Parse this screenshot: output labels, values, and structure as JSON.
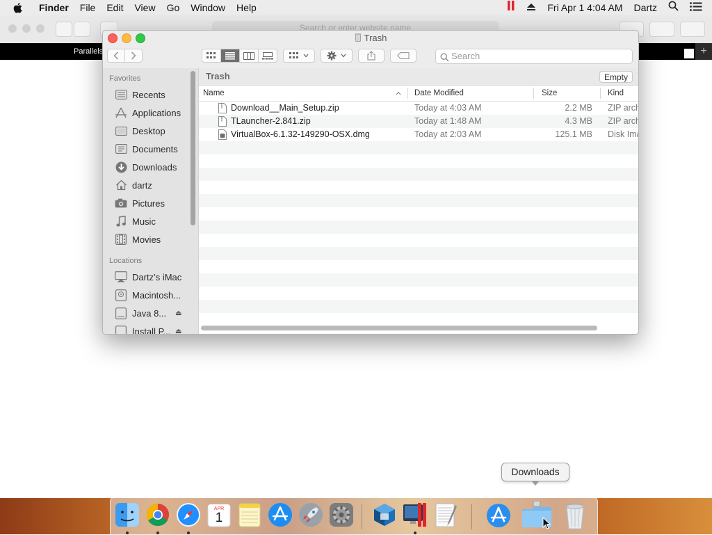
{
  "menubar": {
    "app_name": "Finder",
    "menus": [
      "File",
      "Edit",
      "View",
      "Go",
      "Window",
      "Help"
    ],
    "clock": "Fri Apr 1  4:04 AM",
    "user": "Dartz"
  },
  "background_window": {
    "address_placeholder": "Search or enter website name",
    "tab_label": "Parallels"
  },
  "finder": {
    "window_title": "Trash",
    "search_placeholder": "Search",
    "path_title": "Trash",
    "empty_button": "Empty",
    "columns": {
      "name": "Name",
      "date_modified": "Date Modified",
      "size": "Size",
      "kind": "Kind"
    },
    "files": [
      {
        "name": "Download__Main_Setup.zip",
        "date": "Today at 4:03 AM",
        "size": "2.2 MB",
        "kind": "ZIP archive",
        "icon": "zip-file-icon"
      },
      {
        "name": "TLauncher-2.841.zip",
        "date": "Today at 1:48 AM",
        "size": "4.3 MB",
        "kind": "ZIP archive",
        "icon": "zip-file-icon"
      },
      {
        "name": "VirtualBox-6.1.32-149290-OSX.dmg",
        "date": "Today at 2:03 AM",
        "size": "125.1 MB",
        "kind": "Disk Image",
        "icon": "disk-image-icon"
      }
    ]
  },
  "sidebar": {
    "favorites_header": "Favorites",
    "favorites": [
      {
        "label": "Recents",
        "icon": "recents-icon"
      },
      {
        "label": "Applications",
        "icon": "applications-icon"
      },
      {
        "label": "Desktop",
        "icon": "desktop-icon"
      },
      {
        "label": "Documents",
        "icon": "documents-icon"
      },
      {
        "label": "Downloads",
        "icon": "downloads-icon"
      },
      {
        "label": "dartz",
        "icon": "home-icon"
      },
      {
        "label": "Pictures",
        "icon": "pictures-icon"
      },
      {
        "label": "Music",
        "icon": "music-icon"
      },
      {
        "label": "Movies",
        "icon": "movies-icon"
      }
    ],
    "locations_header": "Locations",
    "locations": [
      {
        "label": "Dartz’s iMac",
        "icon": "imac-icon"
      },
      {
        "label": "Macintosh...",
        "icon": "hard-disk-icon"
      },
      {
        "label": "Java 8...",
        "icon": "external-disk-icon",
        "ejectable": true
      },
      {
        "label": "Install P...",
        "icon": "external-disk-icon",
        "ejectable": true
      }
    ]
  },
  "tooltip": {
    "text": "Downloads"
  },
  "dock": {
    "apps": [
      "Finder",
      "Google Chrome",
      "Safari",
      "Calendar",
      "Notes",
      "App Store",
      "Launchpad",
      "System Preferences",
      "VirtualBox",
      "Parallels Desktop",
      "TextEdit",
      "Applications",
      "Downloads",
      "Trash"
    ],
    "calendar_month": "APR",
    "calendar_day": "1"
  },
  "colors": {
    "close": "#fc605b",
    "minimize": "#fdbc40",
    "maximize": "#34c84a",
    "parallels_red": "#e0262b"
  }
}
